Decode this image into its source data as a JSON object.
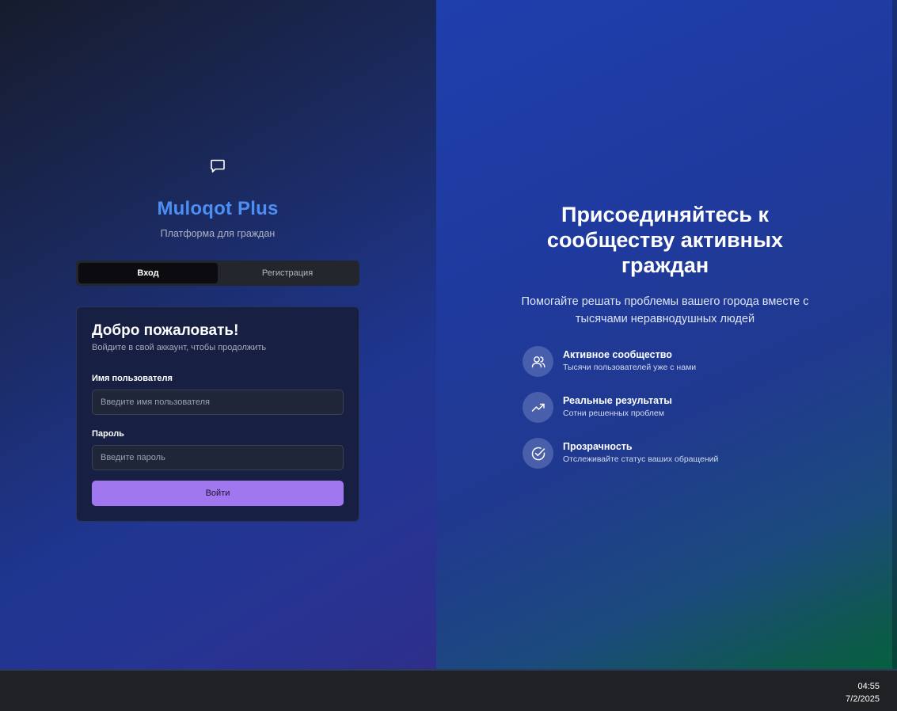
{
  "brand": {
    "title": "Muloqot Plus",
    "subtitle": "Платформа для граждан",
    "icon": "message-square-icon",
    "accent_color": "#4d8ef5"
  },
  "tabs": [
    {
      "label": "Вход",
      "active": true
    },
    {
      "label": "Регистрация",
      "active": false
    }
  ],
  "login_card": {
    "title": "Добро пожаловать!",
    "subtitle": "Войдите в свой аккаунт, чтобы продолжить",
    "username_label": "Имя пользователя",
    "username_placeholder": "Введите имя пользователя",
    "password_label": "Пароль",
    "password_placeholder": "Введите пароль",
    "submit_label": "Войти",
    "submit_color": "#a077ee"
  },
  "hero": {
    "title": "Присоединяйтесь к сообществу активных граждан",
    "subtitle": "Помогайте решать проблемы вашего города вместе с тысячами неравнодушных людей"
  },
  "features": [
    {
      "icon": "users-icon",
      "title": "Активное сообщество",
      "description": "Тысячи пользователей уже с нами"
    },
    {
      "icon": "trending-up-icon",
      "title": "Реальные результаты",
      "description": "Сотни решенных проблем"
    },
    {
      "icon": "check-circle-icon",
      "title": "Прозрачность",
      "description": "Отслеживайте статус ваших обращений"
    }
  ],
  "taskbar": {
    "time": "04:55",
    "date": "7/2/2025"
  }
}
